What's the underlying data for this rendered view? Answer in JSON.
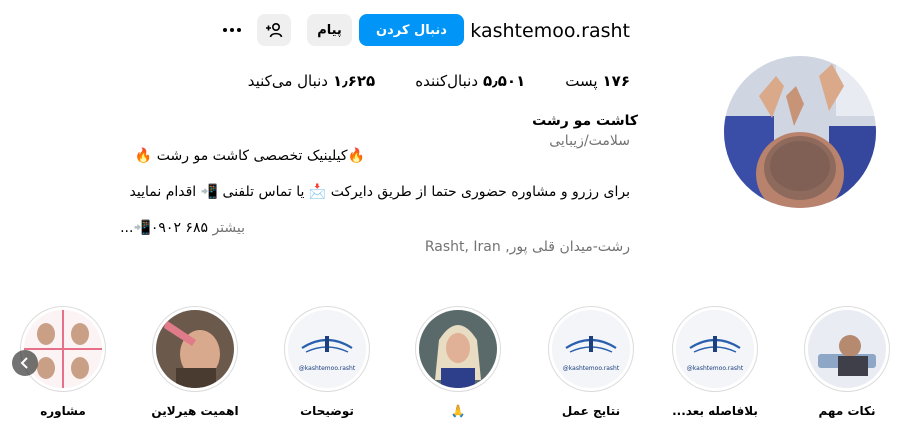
{
  "profile": {
    "username": "kashtemoo.rasht",
    "follow_label": "دنبال کردن",
    "message_label": "پیام",
    "full_name": "کاشت مو رشت",
    "category": "سلامت/زیبایی",
    "bio_line1": "🔥کیلینیک تخصصی کاشت مو رشت 🔥",
    "bio_line2": "برای رزرو و مشاوره حضوری حتما از طریق دایرکت 📩 یا تماس تلفنی 📲 اقدام نمایید",
    "bio_line3": "۶۸۵ ۰۹۰۲📲... ",
    "more_label": "بیشتر",
    "location": "رشت-میدان قلی پور, Rasht, Iran"
  },
  "stats": {
    "posts_count": "۱۷۶",
    "posts_label": "پست",
    "followers_count": "۵٫۵۰۱",
    "followers_label": "دنبال‌کننده",
    "following_count": "۱٫۶۲۵",
    "following_label": "دنبال می‌کنید"
  },
  "highlights": [
    {
      "label": "نکات مهم"
    },
    {
      "label": "بلافاصله بعد..."
    },
    {
      "label": "نتایج عمل"
    },
    {
      "label": "🙏"
    },
    {
      "label": "توضیحات"
    },
    {
      "label": "اهمیت هیرلاین"
    },
    {
      "label": "مشاوره"
    }
  ],
  "logo_text": "@kashtemoo.rasht",
  "colors": {
    "accent": "#0095f6",
    "secondary_text": "#737373"
  }
}
